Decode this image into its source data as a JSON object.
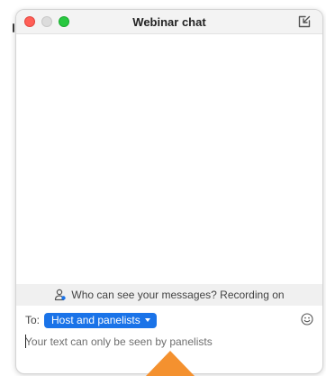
{
  "window": {
    "title": "Webinar chat"
  },
  "notice": {
    "text": "Who can see your messages? Recording on",
    "icon": "person-icon"
  },
  "composer": {
    "to_label": "To:",
    "recipient": "Host and panelists",
    "placeholder": "Your text can only be seen by panelists",
    "value": "",
    "emoji_icon": "smiley-icon"
  },
  "colors": {
    "accent": "#1a73e8",
    "close": "#ff5f57",
    "maximize": "#28c840",
    "pointer_arrow": "#f4912f"
  }
}
